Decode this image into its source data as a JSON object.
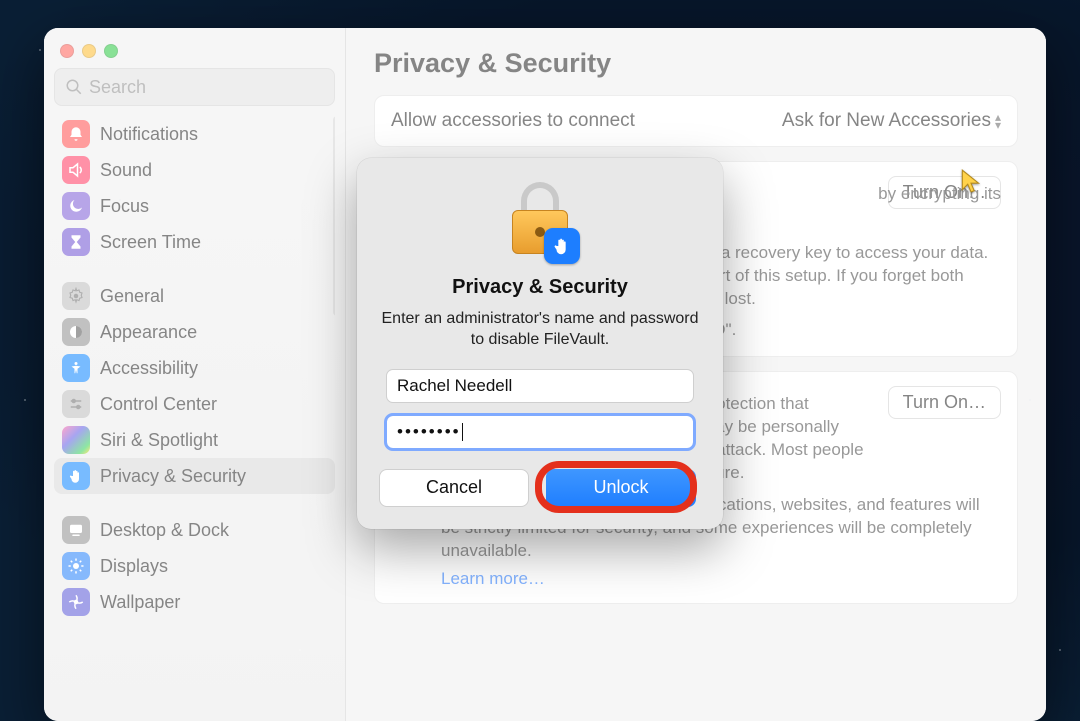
{
  "sidebar": {
    "search_placeholder": "Search",
    "items": [
      {
        "icon": "bell",
        "color": "bg-red",
        "label": "Notifications"
      },
      {
        "icon": "speaker",
        "color": "bg-pink",
        "label": "Sound"
      },
      {
        "icon": "moon",
        "color": "bg-focus",
        "label": "Focus"
      },
      {
        "icon": "hourglass",
        "color": "bg-violet",
        "label": "Screen Time"
      }
    ],
    "items2": [
      {
        "icon": "gear",
        "color": "ic grey",
        "label": "General"
      },
      {
        "icon": "appearance",
        "color": "bg-dkgrey",
        "label": "Appearance"
      },
      {
        "icon": "person",
        "color": "bg-sec",
        "label": "Accessibility"
      },
      {
        "icon": "sliders",
        "color": "ic grey",
        "label": "Control Center"
      },
      {
        "icon": "siri",
        "color": "bg-siri",
        "label": "Siri & Spotlight"
      },
      {
        "icon": "hand",
        "color": "bg-sec",
        "label": "Privacy & Security",
        "selected": true
      }
    ],
    "items3": [
      {
        "icon": "dock",
        "color": "bg-dkgrey",
        "label": "Desktop & Dock"
      },
      {
        "icon": "sun",
        "color": "bg-azure",
        "label": "Displays"
      },
      {
        "icon": "flower",
        "color": "bg-teal",
        "label": "Wallpaper"
      }
    ]
  },
  "page": {
    "title": "Privacy & Security",
    "accessories_label": "Allow accessories to connect",
    "accessories_value": "Ask for New Accessories",
    "turnon1": "Turn On…",
    "turnon2": "Turn On…",
    "filevault_desc_partial1": "by encrypting its",
    "filevault_desc_partial2": "or a recovery key to access your data.",
    "filevault_desc_partial3": "part of this setup. If you forget both",
    "filevault_desc_partial4": "be lost.",
    "filevault_desc_partial5": "HD\".",
    "lockdown_l1": "protection that",
    "lockdown_l2": "may be personally",
    "lockdown_l3": "erattack. Most people",
    "lockdown_l4": "ature.",
    "lockdown_p2": "not function as it typically does. Applications, websites, and features will be strictly limited for security, and some experiences will be completely unavailable.",
    "learn_more": "Learn more…"
  },
  "dialog": {
    "title": "Privacy & Security",
    "message": "Enter an administrator's name and password to disable FileVault.",
    "username": "Rachel Needell",
    "password": "••••••••",
    "cancel": "Cancel",
    "unlock": "Unlock"
  }
}
